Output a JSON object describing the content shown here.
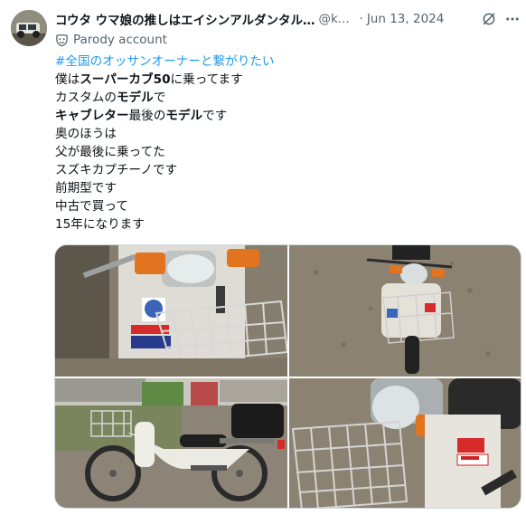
{
  "author": {
    "display_name": "コウタ ウマ娘の推しはエイシンアルダンタル…",
    "handle": "@ko…",
    "separator": "·",
    "date": "Jun 13, 2024",
    "label": "Parody account"
  },
  "icons": {
    "avatar": "avatar",
    "grok": "grok-icon",
    "more": "more-icon",
    "parody": "parody-mask-icon"
  },
  "tweet": {
    "hashtag": "#全国のオッサンオーナーと繋がりたい",
    "line2": [
      {
        "text": "僕は",
        "bold": false
      },
      {
        "text": "スーパーカブ50",
        "bold": true
      },
      {
        "text": "に乗ってます",
        "bold": false
      }
    ],
    "line3": [
      {
        "text": "カスタムの",
        "bold": false
      },
      {
        "text": "モデル",
        "bold": true
      },
      {
        "text": "で",
        "bold": false
      }
    ],
    "line4": [
      {
        "text": "キャブレター",
        "bold": true
      },
      {
        "text": "最後の",
        "bold": false
      },
      {
        "text": "モデル",
        "bold": true
      },
      {
        "text": "です",
        "bold": false
      }
    ],
    "line5": "奥のほうは",
    "line6": "父が最後に乗ってた",
    "line7": "スズキカプチーノです",
    "line8": "前期型です",
    "line9": "中古で買って",
    "line10": "15年になります"
  },
  "colors": {
    "hashtag": "#1d9bf0",
    "secondary_text": "#536471",
    "primary_text": "#0f1419",
    "border": "#cfd9de",
    "bike_body": "#e9e7de",
    "gravel": "#8a8173",
    "orange_light": "#e2731f"
  }
}
